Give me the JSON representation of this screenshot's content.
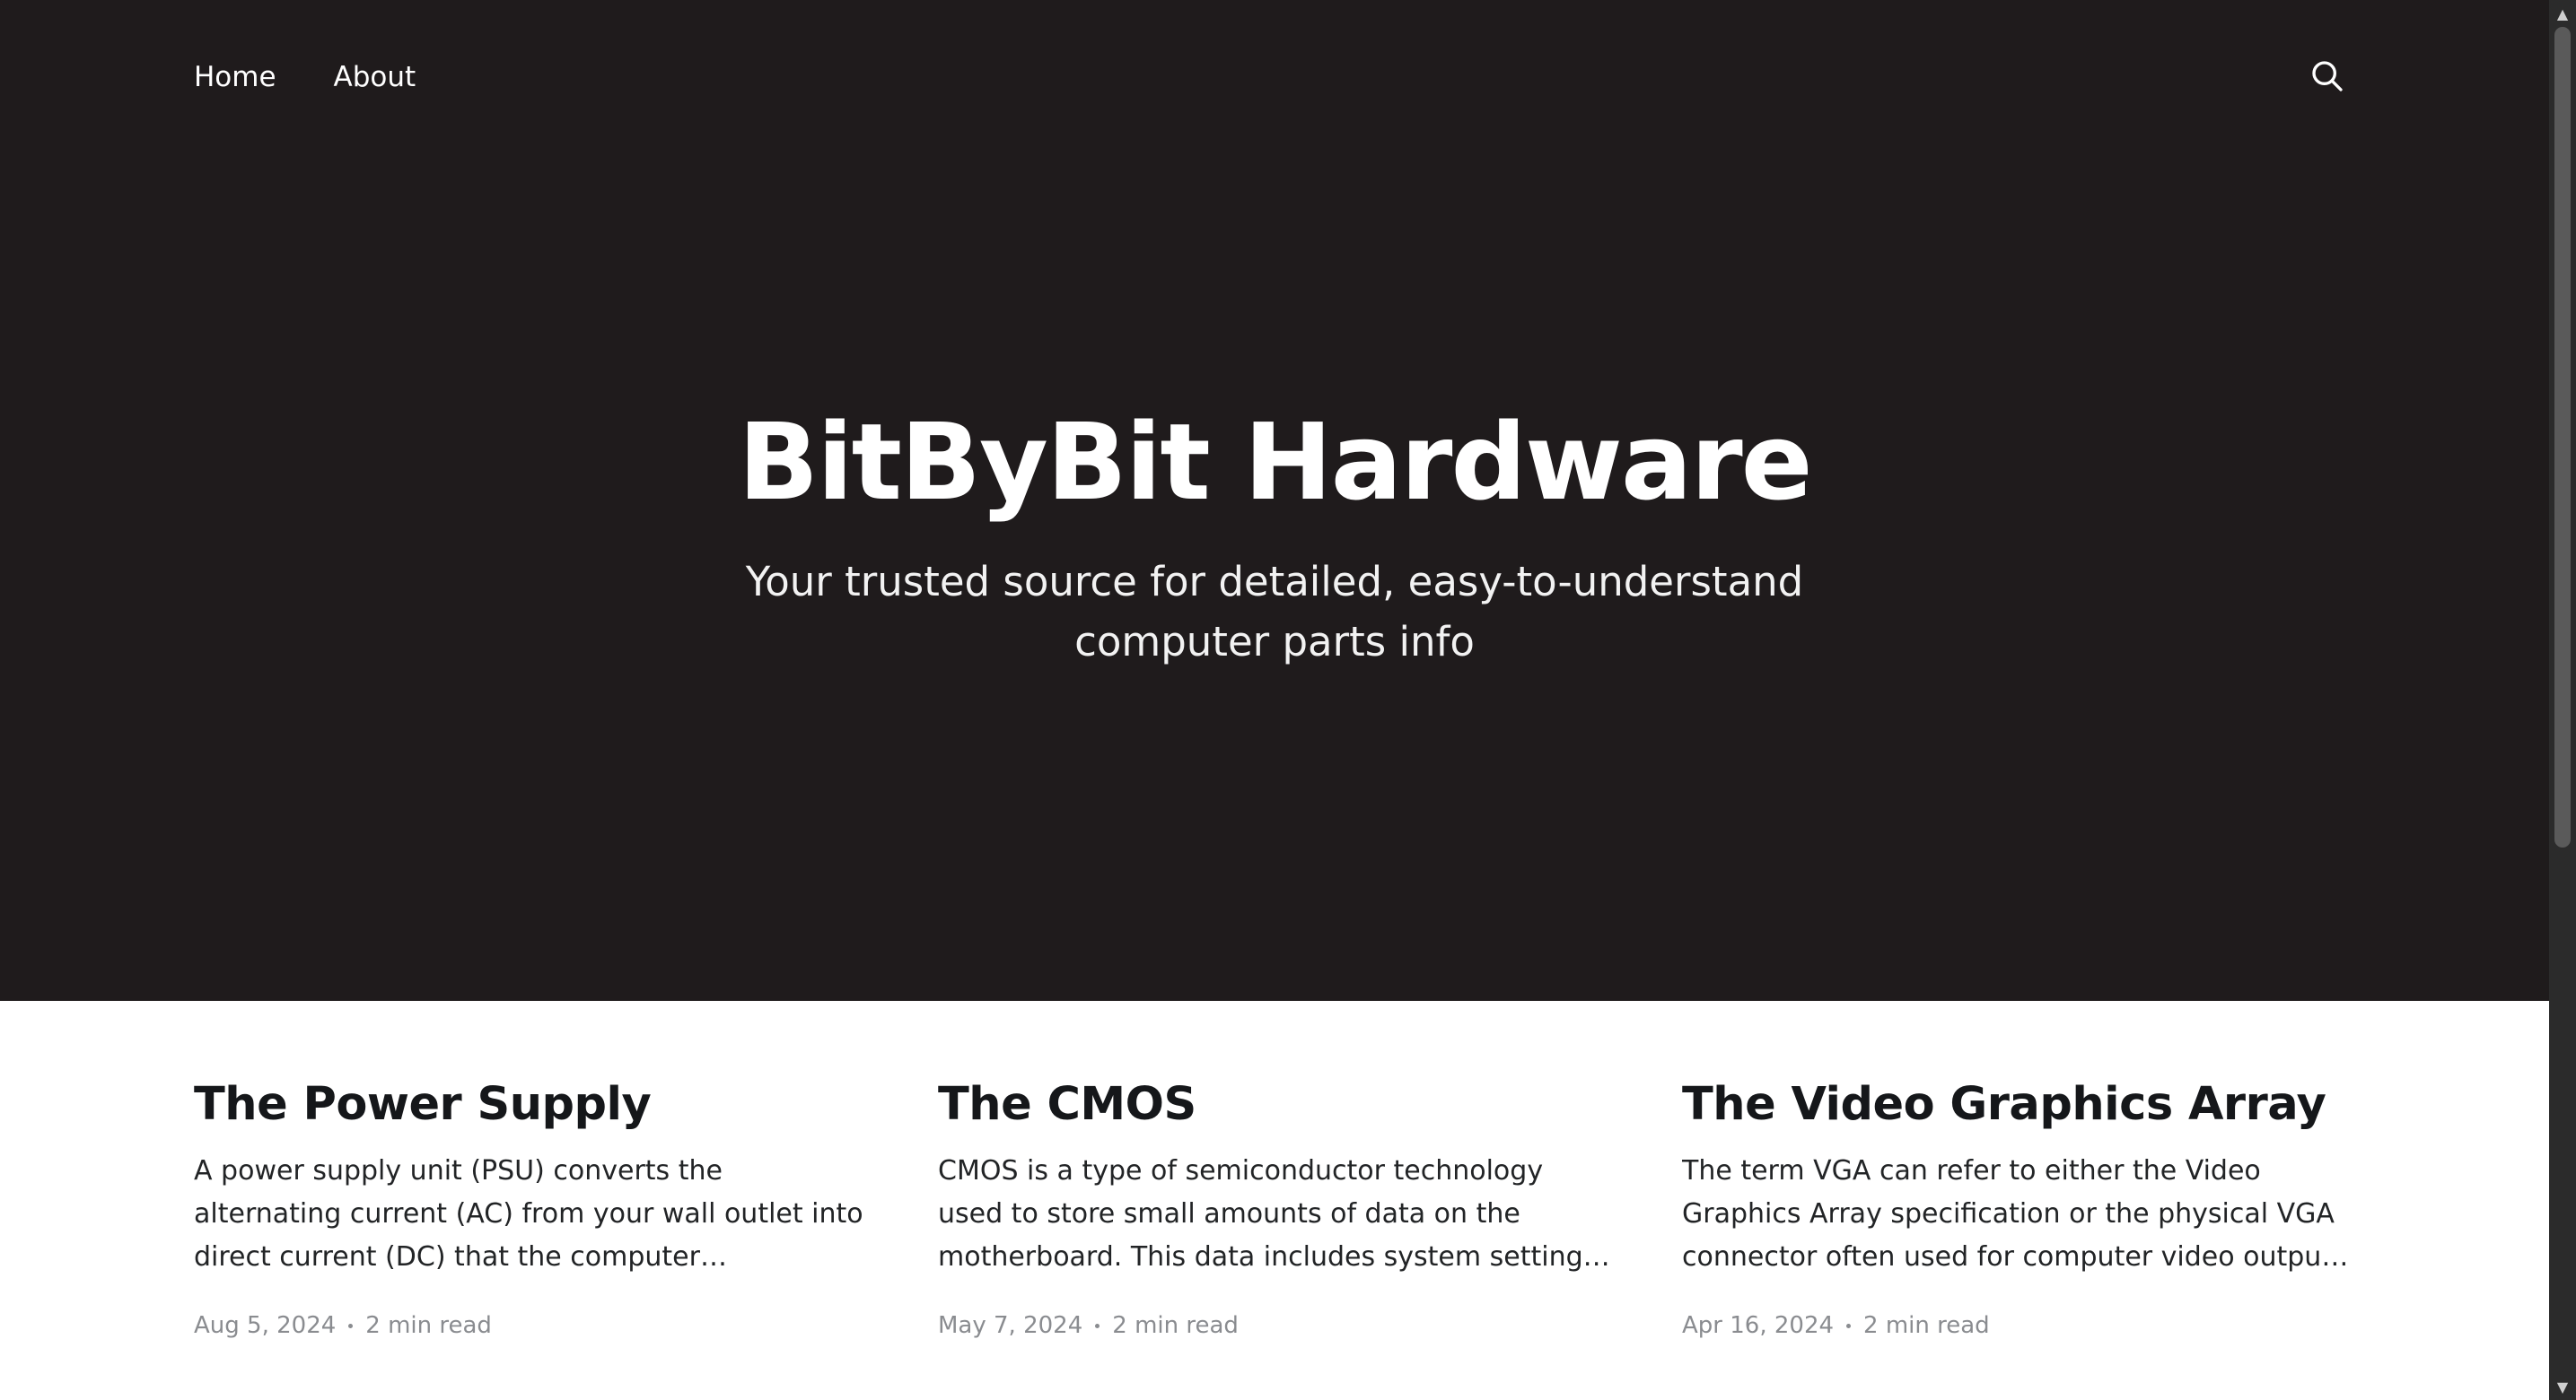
{
  "nav": {
    "home_label": "Home",
    "about_label": "About"
  },
  "header": {
    "search_icon": "search-icon"
  },
  "hero": {
    "title": "BitByBit Hardware",
    "description": "Your trusted source for detailed, easy-to-understand computer parts info"
  },
  "posts": [
    {
      "title": "The Power Supply",
      "excerpt": "A power supply unit (PSU) converts the alternating current (AC) from your wall outlet into direct current (DC) that the computer components require. It…",
      "date": "Aug 5, 2024",
      "read_time": "2 min read"
    },
    {
      "title": "The CMOS",
      "excerpt": "CMOS is a type of semiconductor technology used to store small amounts of data on the motherboard. This data includes system settings and configuratio…",
      "date": "May 7, 2024",
      "read_time": "2 min read"
    },
    {
      "title": "The Video Graphics Array",
      "excerpt": "The term VGA can refer to either the Video Graphics Array specification or the physical VGA connector often used for computer video output. Below, I'll…",
      "date": "Apr 16, 2024",
      "read_time": "2 min read"
    }
  ],
  "colors": {
    "hero_background": "#1f1b1c",
    "text_dark": "#15171a",
    "meta_gray": "#8a8c90"
  }
}
